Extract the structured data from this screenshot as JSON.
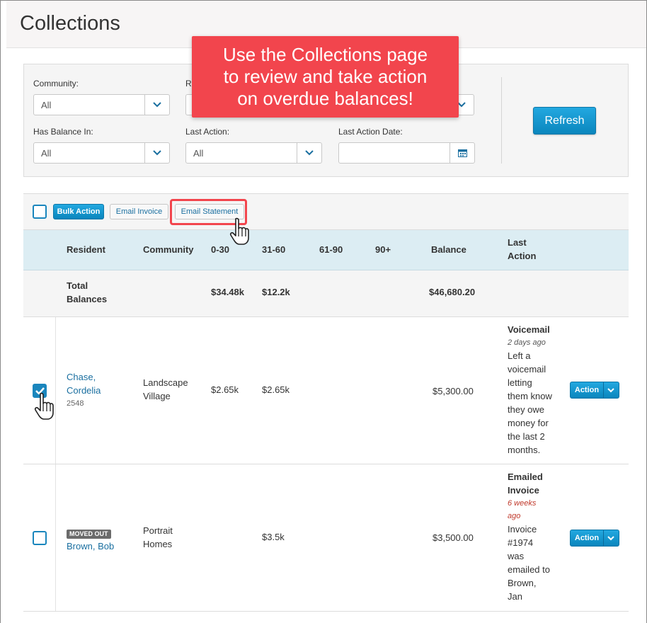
{
  "page": {
    "title": "Collections"
  },
  "callout": {
    "lines": [
      "Use the Collections page",
      "to review and take action",
      "on overdue balances!"
    ]
  },
  "filters": {
    "community": {
      "label": "Community:",
      "value": "All"
    },
    "row1_col2_label": "R",
    "has_balance_in": {
      "label": "Has Balance In:",
      "value": "All"
    },
    "last_action": {
      "label": "Last Action:",
      "value": "All"
    },
    "last_action_date": {
      "label": "Last Action Date:",
      "value": ""
    },
    "refresh_label": "Refresh"
  },
  "toolbar": {
    "bulk_action": "Bulk Action",
    "email_invoice": "Email Invoice",
    "email_statement": "Email Statement"
  },
  "table": {
    "headers": {
      "resident": "Resident",
      "community": "Community",
      "b0_30": "0-30",
      "b31_60": "31-60",
      "b61_90": "61-90",
      "b90": "90+",
      "balance": "Balance",
      "last_action_1": "Last",
      "last_action_2": "Action"
    },
    "totals": {
      "label_1": "Total",
      "label_2": "Balances",
      "b0_30": "$34.48k",
      "b31_60": "$12.2k",
      "balance": "$46,680.20"
    },
    "rows": [
      {
        "checked": true,
        "name_1": "Chase,",
        "name_2": "Cordelia",
        "id": "2548",
        "community_1": "Landscape",
        "community_2": "Village",
        "b0_30": "$2.65k",
        "b31_60": "$2.65k",
        "balance": "$5,300.00",
        "last_action": {
          "type": "Voicemail",
          "time": "2 days ago",
          "note_lines": [
            "Left a",
            "voicemail",
            "letting",
            "them know",
            "they owe",
            "money for",
            "the last 2",
            "months."
          ]
        },
        "action_label": "Action"
      },
      {
        "checked": false,
        "badge": "MOVED OUT",
        "name": "Brown, Bob",
        "community_1": "Portrait",
        "community_2": "Homes",
        "b31_60": "$3.5k",
        "balance": "$3,500.00",
        "last_action": {
          "type_1": "Emailed",
          "type_2": "Invoice",
          "time_1": "6 weeks",
          "time_2": "ago",
          "note_lines": [
            "Invoice",
            "#1974",
            "was",
            "emailed to",
            "Brown,",
            "Jan"
          ]
        },
        "action_label": "Action"
      }
    ]
  },
  "colors": {
    "primary": "#1a86bd",
    "callout": "#f2454d",
    "header_bg": "#dcedf3"
  }
}
